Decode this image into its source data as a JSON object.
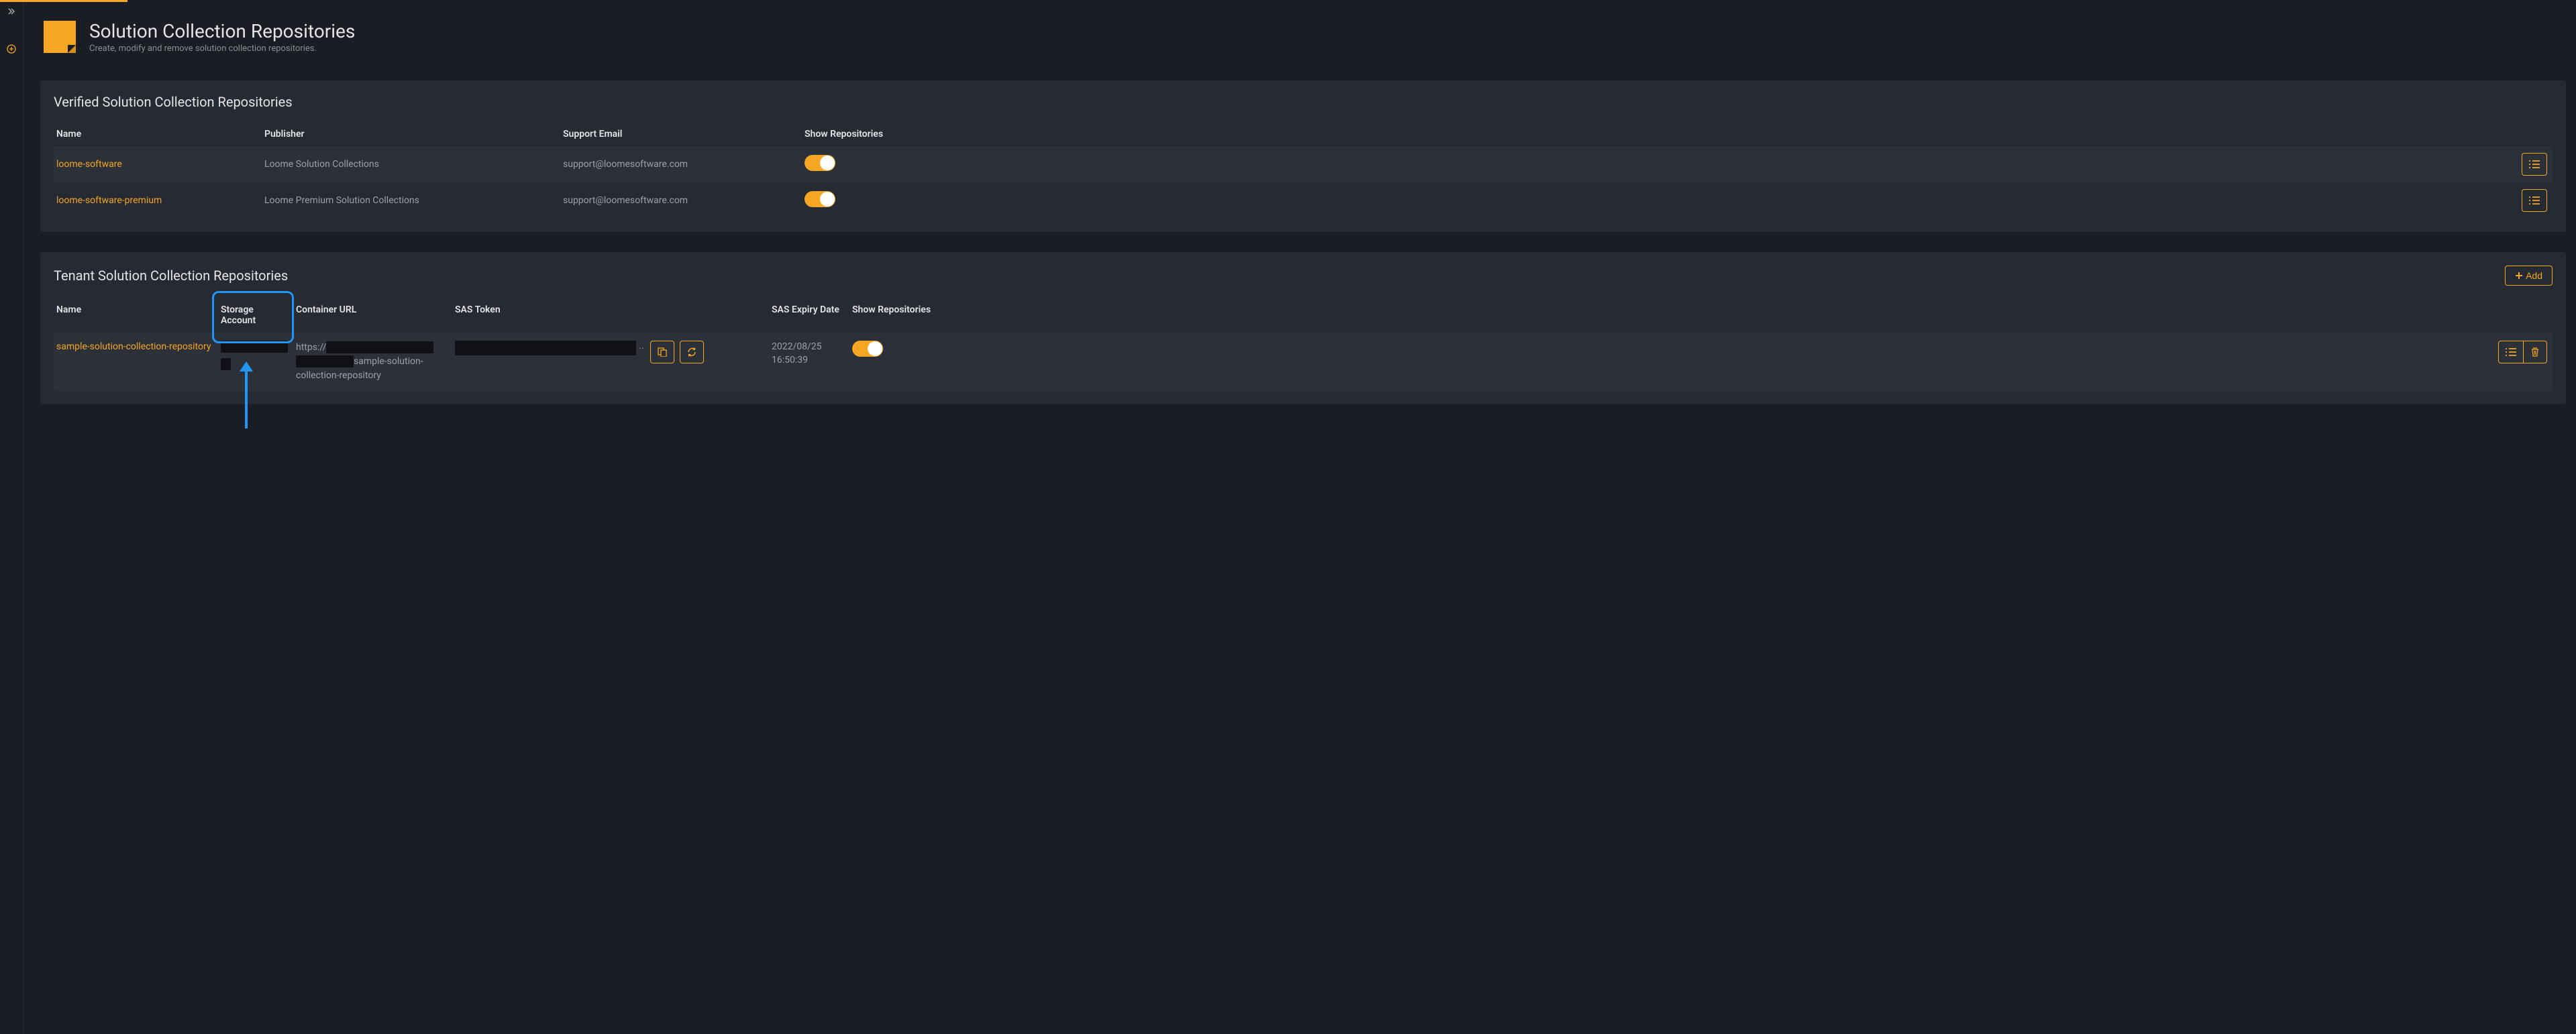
{
  "page": {
    "title": "Solution Collection Repositories",
    "subtitle": "Create, modify and remove solution collection repositories."
  },
  "verified_panel": {
    "title": "Verified Solution Collection Repositories",
    "headers": {
      "name": "Name",
      "publisher": "Publisher",
      "support_email": "Support Email",
      "show_repos": "Show Repositories"
    },
    "rows": [
      {
        "name": "loome-software",
        "publisher": "Loome Solution Collections",
        "support_email": "support@loomesoftware.com",
        "toggle_on": true
      },
      {
        "name": "loome-software-premium",
        "publisher": "Loome Premium Solution Collections",
        "support_email": "support@loomesoftware.com",
        "toggle_on": true
      }
    ]
  },
  "tenant_panel": {
    "title": "Tenant Solution Collection Repositories",
    "add_label": "Add",
    "headers": {
      "name": "Name",
      "storage": "Storage Account",
      "container_url": "Container URL",
      "sas": "SAS Token",
      "expiry": "SAS Expiry Date",
      "show_repos": "Show Repositories"
    },
    "rows": [
      {
        "name": "sample-solution-collection-repository",
        "url_prefix": "https://",
        "url_suffix": "sample-solution-collection-repository",
        "expiry_date": "2022/08/25",
        "expiry_time": "16:50:39",
        "toggle_on": true
      }
    ]
  }
}
